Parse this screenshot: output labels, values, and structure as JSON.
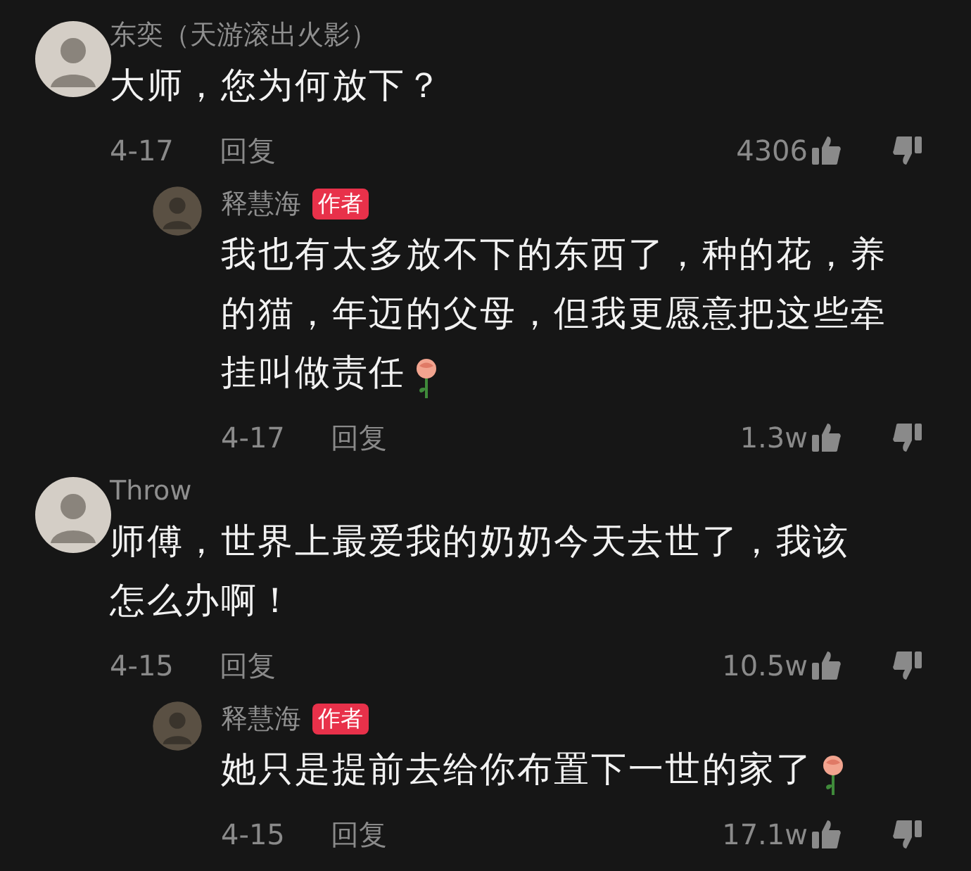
{
  "comments": [
    {
      "name": "东奕（天游滚出火影）",
      "text": "大师，您为何放下？",
      "flower": false,
      "date": "4-17",
      "reply_label": "回复",
      "likes": "4306",
      "replies": [
        {
          "name": "释慧海",
          "author_badge": "作者",
          "text": "我也有太多放不下的东西了，种的花，养的猫，年迈的父母，但我更愿意把这些牵挂叫做责任",
          "flower": true,
          "date": "4-17",
          "reply_label": "回复",
          "likes": "1.3w"
        }
      ]
    },
    {
      "name": "Throw",
      "text": "师傅，世界上最爱我的奶奶今天去世了，我该怎么办啊！",
      "flower": false,
      "date": "4-15",
      "reply_label": "回复",
      "likes": "10.5w",
      "replies": [
        {
          "name": "释慧海",
          "author_badge": "作者",
          "text": "她只是提前去给你布置下一世的家了",
          "flower": true,
          "date": "4-15",
          "reply_label": "回复",
          "likes": "17.1w"
        }
      ]
    }
  ]
}
